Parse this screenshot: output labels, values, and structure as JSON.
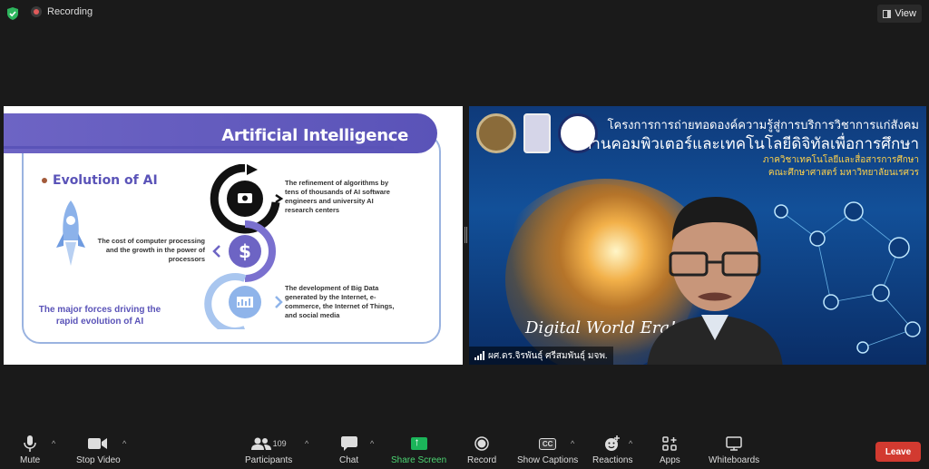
{
  "top_bar": {
    "recording_label": "Recording",
    "view_label": "View"
  },
  "slide": {
    "title": "Artificial Intelligence",
    "subtitle": "Evolution of AI",
    "text_algorithms": "The refinement of algorithms by tens of thousands of AI software engineers and university AI research centers",
    "text_cost": "The cost of computer processing and the growth in the power of processors",
    "text_bigdata": "The development of Big Data generated by the Internet, e-commerce, the Internet of Things, and social media",
    "text_forces": "The major forces driving the rapid evolution of AI"
  },
  "video": {
    "thai_line1": "โครงการการถ่ายทอดองค์ความรู้สู่การบริการวิชาการแก่สังคม",
    "thai_line2": "ด้านคอมพิวเตอร์และเทคโนโลยีดิจิทัลเพื่อการศึกษา",
    "thai_line3": "ภาควิชาเทคโนโลยีและสื่อสารการศึกษา",
    "thai_line4": "คณะศึกษาศาสตร์ มหาวิทยาลัยนเรศวร",
    "era_text": "Digital World Era!",
    "participant_name": "ผศ.ดร.จิรพันธุ์ ศรีสมพันธุ์ มจพ."
  },
  "toolbar": {
    "mute": "Mute",
    "stop_video": "Stop Video",
    "participants": "Participants",
    "participants_count": "109",
    "chat": "Chat",
    "share_screen": "Share Screen",
    "record": "Record",
    "captions": "Show Captions",
    "captions_icon_text": "CC",
    "reactions": "Reactions",
    "apps": "Apps",
    "whiteboards": "Whiteboards",
    "leave": "Leave"
  },
  "colors": {
    "share_green": "#1bb55a",
    "leave_red": "#d23a30",
    "slide_purple": "#5a53b8"
  }
}
